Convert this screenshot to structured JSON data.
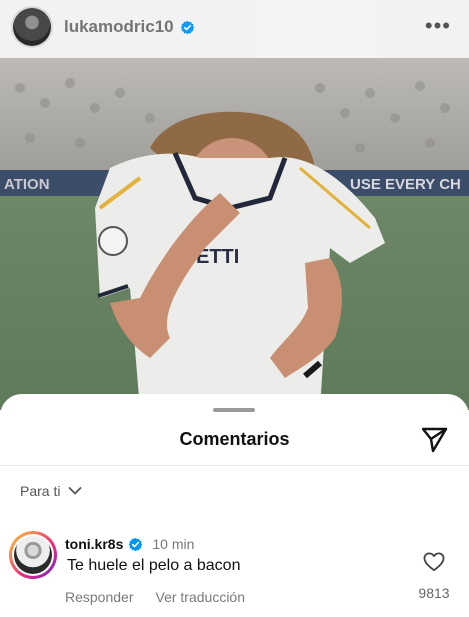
{
  "header": {
    "username": "lukamodric10",
    "verified": true,
    "more_icon": "more-horizontal-icon"
  },
  "post_image": {
    "alt_icon": "post-photo",
    "banner_left": "ATION",
    "banner_right": "USE EVERY CH",
    "shirt_text": "ETTI"
  },
  "sheet": {
    "title": "Comentarios",
    "share_icon": "share-icon",
    "filter_label": "Para ti"
  },
  "comment": {
    "username": "toni.kr8s",
    "verified": true,
    "time": "10 min",
    "text": "Te huele el pelo a bacon",
    "reply_label": "Responder",
    "translate_label": "Ver traducción",
    "likes": "9813"
  },
  "colors": {
    "verified_blue": "#0095f6",
    "pitch_green": "#6f8a66"
  }
}
